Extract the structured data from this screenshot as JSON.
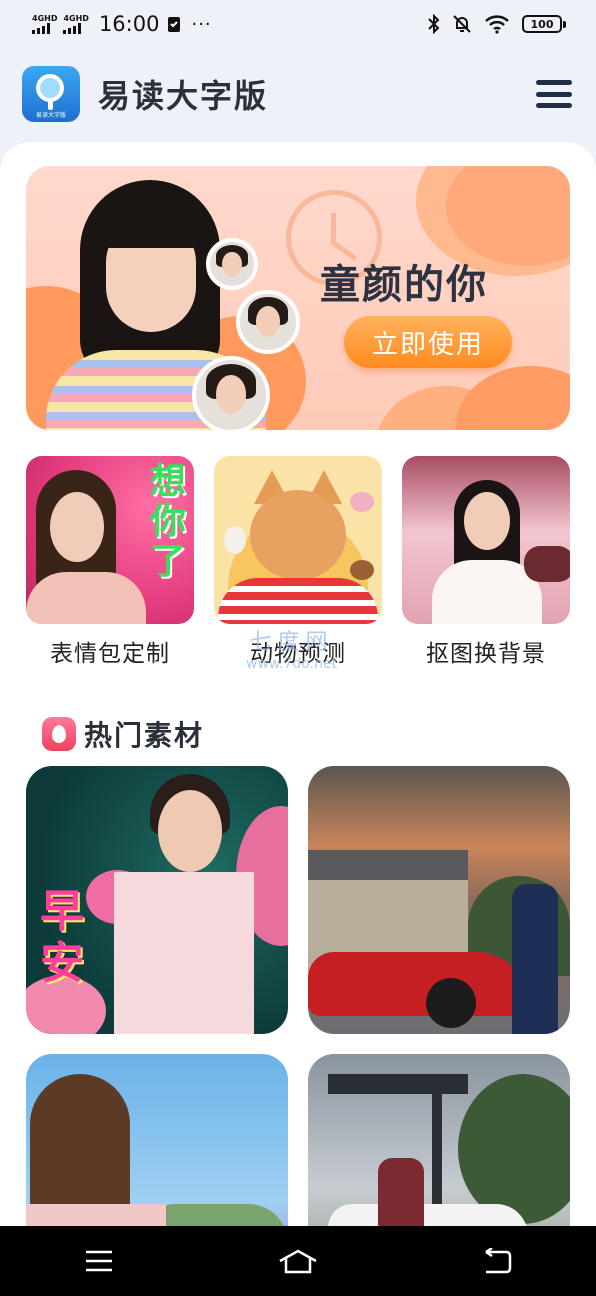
{
  "status_bar": {
    "sim1": "4GHD",
    "sim2": "4GHD",
    "time": "16:00",
    "more": "···",
    "battery": "100"
  },
  "header": {
    "title": "易读大字版",
    "logo_text": "易读大字版"
  },
  "banner": {
    "title": "童颜的你",
    "cta": "立即使用"
  },
  "features": [
    {
      "label": "表情包定制",
      "overlay_text": "想你了"
    },
    {
      "label": "动物预测"
    },
    {
      "label": "抠图换背景"
    }
  ],
  "watermark": {
    "line1": "七度网",
    "line2": "www.7do.net"
  },
  "hot_section": {
    "title": "热门素材",
    "items": [
      {
        "overlay_text": "早安"
      },
      {},
      {},
      {}
    ]
  },
  "colors": {
    "accent": "#ff8a1e",
    "hot": "#f2405f",
    "title": "#2a2f3a"
  },
  "icons": [
    "signal-icon",
    "clipboard-icon",
    "bluetooth-icon",
    "mute-bell-icon",
    "wifi-icon",
    "battery-icon",
    "menu-icon",
    "fire-icon",
    "nav-recents-icon",
    "nav-home-icon",
    "nav-back-icon"
  ]
}
